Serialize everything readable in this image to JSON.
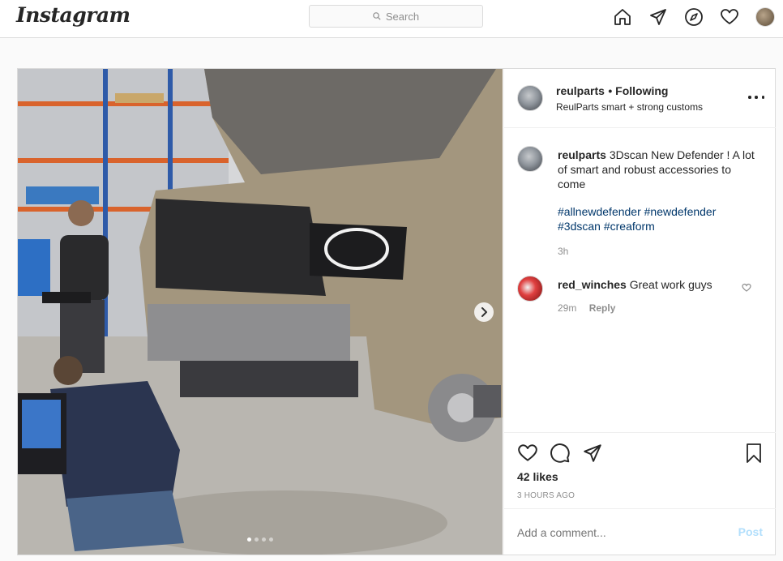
{
  "app": {
    "logo": "Instagram"
  },
  "search": {
    "placeholder": "Search"
  },
  "nav": {
    "icons": [
      "home-icon",
      "direct-icon",
      "explore-icon",
      "activity-icon",
      "profile-avatar"
    ]
  },
  "post": {
    "author": "reulparts",
    "following_label": "• Following",
    "subtitle": "ReulParts smart + strong customs",
    "caption": {
      "username": "reulparts",
      "text": "3Dscan New Defender ! A lot of smart and robust accessories to come",
      "hashtags": [
        "#allnewdefender",
        "#newdefender",
        "#3dscan",
        "#creaform"
      ],
      "time": "3h"
    },
    "comments": [
      {
        "username": "red_winches",
        "text": "Great work guys",
        "time": "29m",
        "reply_label": "Reply"
      }
    ],
    "likes": "42 likes",
    "time_ago": "3 HOURS AGO",
    "carousel": {
      "count": 4,
      "active": 0
    },
    "add_comment_placeholder": "Add a comment...",
    "post_label": "Post"
  },
  "colors": {
    "text": "#262626",
    "muted": "#8e8e8e",
    "hashtag": "#00376b",
    "post_button_disabled": "#b2dffc",
    "border": "#dbdbdb"
  }
}
